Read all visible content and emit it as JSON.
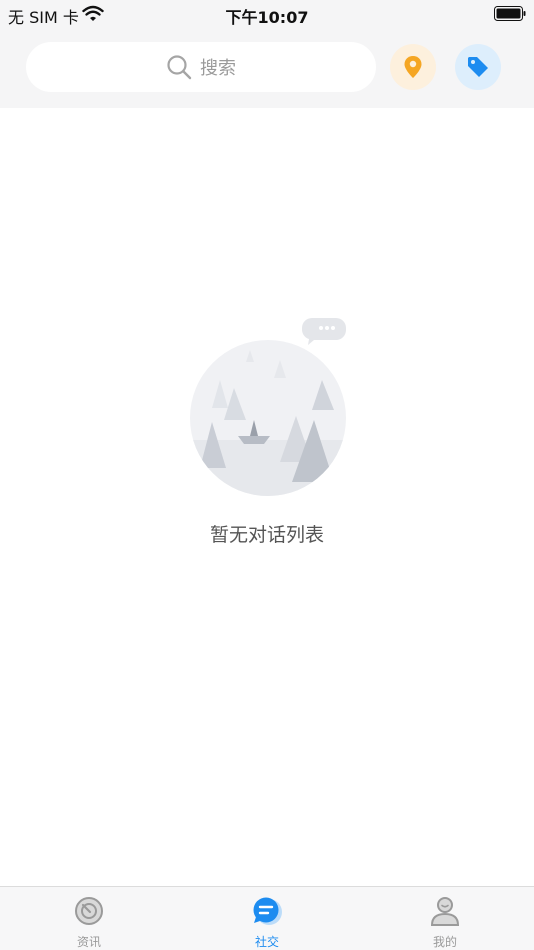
{
  "status_bar": {
    "carrier": "无 SIM 卡",
    "time": "下午10:07"
  },
  "header": {
    "search_placeholder": "搜索",
    "location_icon": "location-pin-icon",
    "tag_icon": "tag-icon",
    "location_color": "#f5a623",
    "tag_color": "#1d8cf0"
  },
  "empty_state": {
    "message": "暂无对话列表",
    "illustration_icon": "empty-landscape-icon"
  },
  "tab_bar": {
    "active_index": 1,
    "active_color": "#1d8cf0",
    "tabs": [
      {
        "label": "资讯",
        "icon": "news-icon"
      },
      {
        "label": "社交",
        "icon": "chat-icon"
      },
      {
        "label": "我的",
        "icon": "profile-icon"
      }
    ]
  }
}
